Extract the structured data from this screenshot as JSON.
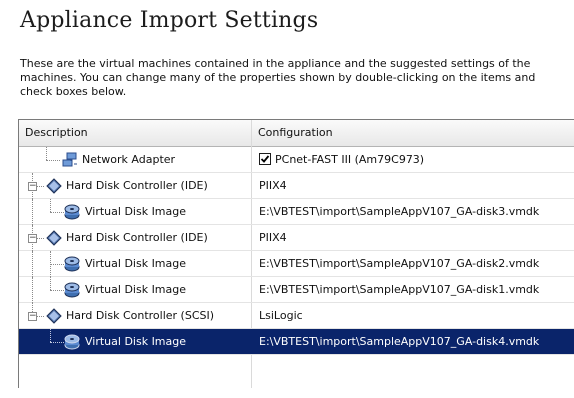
{
  "page": {
    "title": "Appliance Import Settings",
    "description_lines": [
      "These are the virtual machines contained in the appliance and the suggested settings of the",
      "machines. You can change many of the properties shown by double-clicking on the items and",
      "check boxes below."
    ]
  },
  "table": {
    "columns": [
      "Description",
      "Configuration"
    ],
    "rows": [
      {
        "description": "Network Adapter",
        "configuration": "PCnet-FAST III (Am79C973)",
        "icon": "network-adapter-icon",
        "checked": true
      },
      {
        "description": "Hard Disk Controller (IDE)",
        "configuration": "PIIX4",
        "icon": "disk-controller-icon",
        "expanded": true
      },
      {
        "description": "Virtual Disk Image",
        "configuration": "E:\\VBTEST\\import\\SampleAppV107_GA-disk3.vmdk",
        "icon": "virtual-disk-icon"
      },
      {
        "description": "Hard Disk Controller (IDE)",
        "configuration": "PIIX4",
        "icon": "disk-controller-icon",
        "expanded": true
      },
      {
        "description": "Virtual Disk Image",
        "configuration": "E:\\VBTEST\\import\\SampleAppV107_GA-disk2.vmdk",
        "icon": "virtual-disk-icon"
      },
      {
        "description": "Virtual Disk Image",
        "configuration": "E:\\VBTEST\\import\\SampleAppV107_GA-disk1.vmdk",
        "icon": "virtual-disk-icon"
      },
      {
        "description": "Hard Disk Controller (SCSI)",
        "configuration": "LsiLogic",
        "icon": "disk-controller-icon",
        "expanded": true
      },
      {
        "description": "Virtual Disk Image",
        "configuration": "E:\\VBTEST\\import\\SampleAppV107_GA-disk4.vmdk",
        "icon": "virtual-disk-icon",
        "selected": true
      }
    ]
  },
  "colors": {
    "selection": "#0a246a",
    "selection_text": "#ffffff"
  }
}
